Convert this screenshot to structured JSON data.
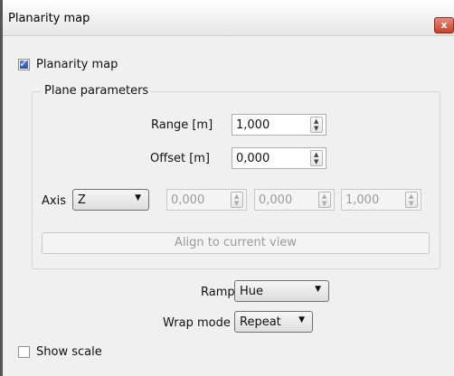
{
  "window": {
    "title": "Planarity map",
    "close_glyph": "x"
  },
  "planarity_checkbox": {
    "label": "Planarity map",
    "checked": true
  },
  "plane_parameters": {
    "legend": "Plane parameters",
    "range": {
      "label": "Range [m]",
      "value": "1,000"
    },
    "offset": {
      "label": "Offset [m]",
      "value": "0,000"
    },
    "axis": {
      "label": "Axis",
      "selected": "Z",
      "normal_x": "0,000",
      "normal_y": "0,000",
      "normal_z": "1,000"
    },
    "align_button": "Align to current view"
  },
  "ramp": {
    "label": "Ramp",
    "selected": "Hue"
  },
  "wrap_mode": {
    "label": "Wrap mode",
    "selected": "Repeat"
  },
  "show_scale": {
    "label": "Show scale",
    "checked": false
  },
  "glyphs": {
    "dropdown": "▼",
    "spin_up": "▲",
    "spin_down": "▼"
  }
}
